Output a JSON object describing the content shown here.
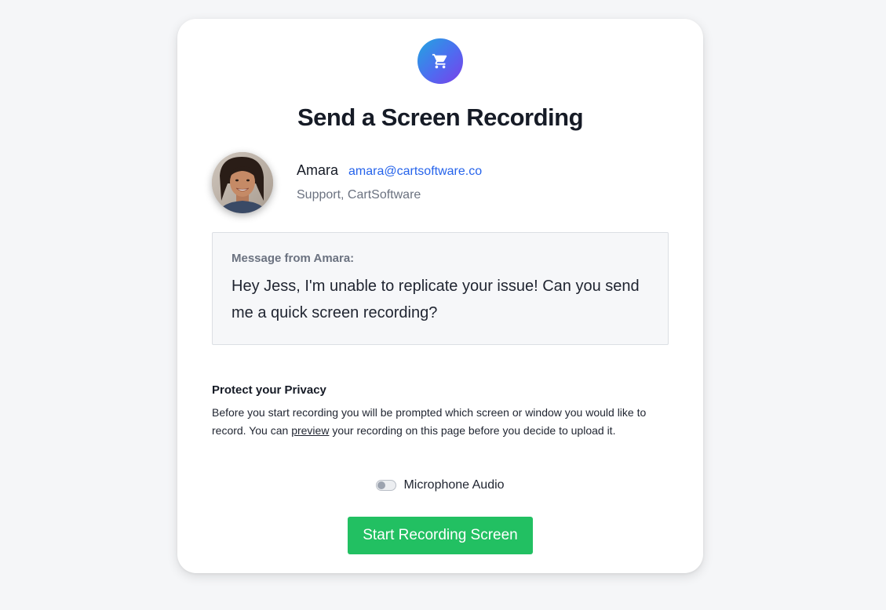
{
  "page": {
    "title": "Send a Screen Recording"
  },
  "sender": {
    "name": "Amara",
    "email": "amara@cartsoftware.co",
    "role": "Support, CartSoftware"
  },
  "message": {
    "label": "Message from Amara:",
    "text": "Hey Jess, I'm unable to replicate your issue! Can you send me a quick screen recording?"
  },
  "privacy": {
    "title": "Protect your Privacy",
    "text_before": "Before you start recording you will be prompted which screen or window you would like to record. You can ",
    "link": "preview",
    "text_after": " your recording on this page before you decide to upload it."
  },
  "microphone": {
    "label": "Microphone Audio",
    "enabled": false
  },
  "actions": {
    "start_label": "Start Recording Screen"
  },
  "icons": {
    "logo": "shopping-cart-icon"
  },
  "colors": {
    "primary_button": "#22c062",
    "email_link": "#2563eb",
    "logo_gradient_start": "#21a6e0",
    "logo_gradient_end": "#7b3fe8"
  }
}
